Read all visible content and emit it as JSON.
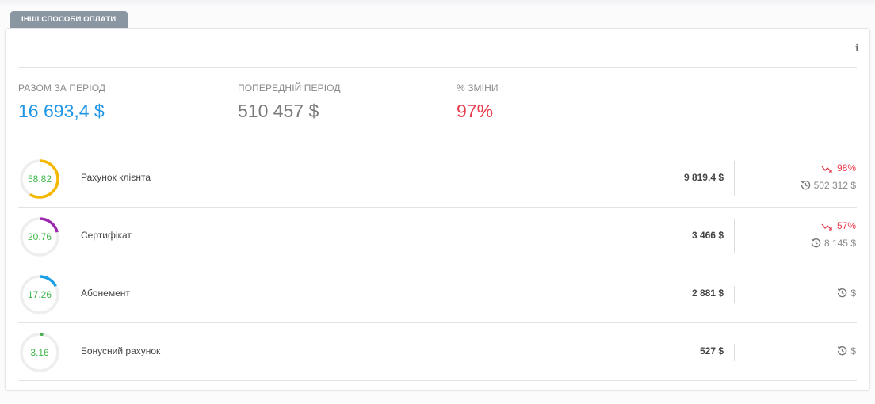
{
  "tab": {
    "label": "ІНШІ СПОСОБИ ОПЛАТИ"
  },
  "info_icon": "info-icon",
  "summary": {
    "total": {
      "label": "РАЗОМ ЗА ПЕРІОД",
      "value": "16 693,4 $"
    },
    "previous": {
      "label": "ПОПЕРЕДНІЙ ПЕРІОД",
      "value": "510 457 $"
    },
    "change": {
      "label": "% ЗМІНИ",
      "value": "97%"
    }
  },
  "rows": [
    {
      "percent_label": "58.82",
      "percent": 58.82,
      "color": "#f5b800",
      "name": "Рахунок клієнта",
      "amount": "9 819,4 $",
      "change": "98%",
      "previous": "502 312 $"
    },
    {
      "percent_label": "20.76",
      "percent": 20.76,
      "color": "#9c27b0",
      "name": "Сертифікат",
      "amount": "3 466 $",
      "change": "57%",
      "previous": "8 145 $"
    },
    {
      "percent_label": "17.26",
      "percent": 17.26,
      "color": "#1ba0e8",
      "name": "Абонемент",
      "amount": "2 881 $",
      "change": "",
      "previous": "$"
    },
    {
      "percent_label": "3.16",
      "percent": 3.16,
      "color": "#4caf50",
      "name": "Бонусний рахунок",
      "amount": "527 $",
      "change": "",
      "previous": "$"
    }
  ],
  "colors": {
    "accent_blue": "#2196e6",
    "negative_red": "#e83b4d",
    "positive_green": "#3fb84a",
    "ring_track": "#eeeeee"
  },
  "icons": {
    "trend_down": "trend-down-icon",
    "history": "history-icon"
  }
}
